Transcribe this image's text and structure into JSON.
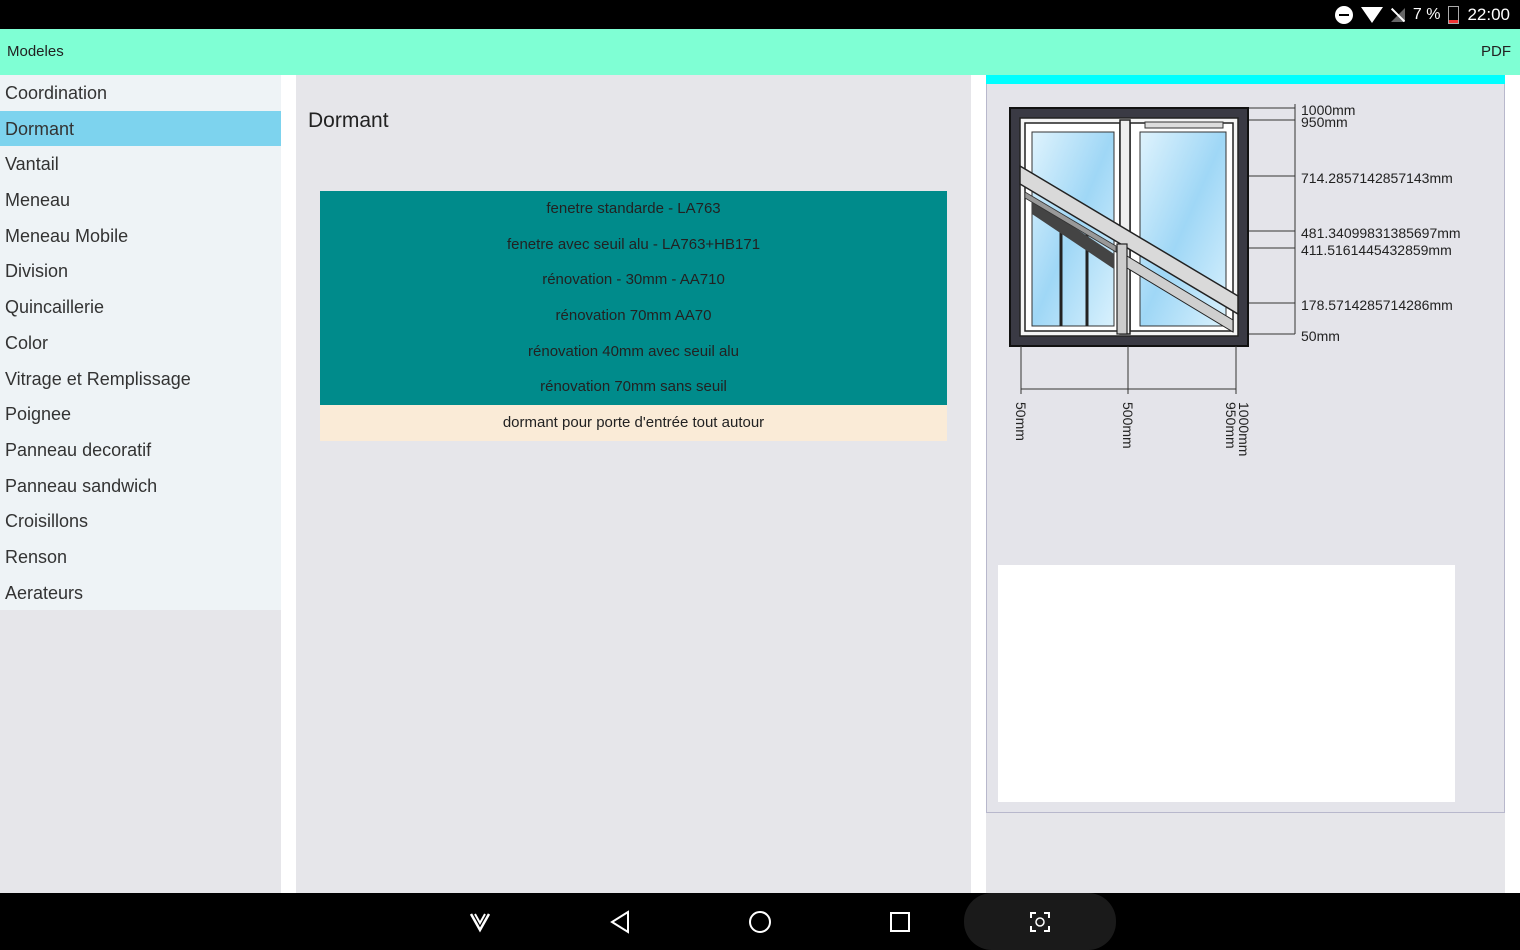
{
  "status": {
    "battery": "7 %",
    "time": "22:00"
  },
  "appbar": {
    "title": "Modeles",
    "pdf": "PDF"
  },
  "sidebar": {
    "items": [
      "Coordination",
      "Dormant",
      "Vantail",
      "Meneau",
      "Meneau Mobile",
      "Division",
      "Quincaillerie",
      "Color",
      "Vitrage et Remplissage",
      "Poignee",
      "Panneau decoratif",
      "Panneau sandwich",
      "Croisillons",
      "Renson",
      "Aerateurs"
    ],
    "active_index": 1
  },
  "main": {
    "title": "Dormant",
    "options": [
      "fenetre standarde - LA763",
      "fenetre avec seuil alu - LA763+HB171",
      "rénovation - 30mm - AA710",
      "rénovation 70mm AA70",
      "rénovation 40mm avec seuil alu",
      "rénovation 70mm sans seuil",
      "dormant pour porte d'entrée tout autour"
    ]
  },
  "drawing": {
    "vertical_dims": [
      "1000mm",
      "950mm",
      "714.2857142857143mm",
      "481.34099831385697mm",
      "411.5161445432859mm",
      "178.5714285714286mm",
      "50mm"
    ],
    "horizontal_dims": [
      "50mm",
      "500mm",
      "1000mm",
      "950mm"
    ]
  },
  "colors": {
    "appbar": "#7fffd4",
    "active": "#7dd3ee",
    "option": "#008b8b",
    "option_alt": "#faebd7",
    "accent": "#00ffff"
  }
}
